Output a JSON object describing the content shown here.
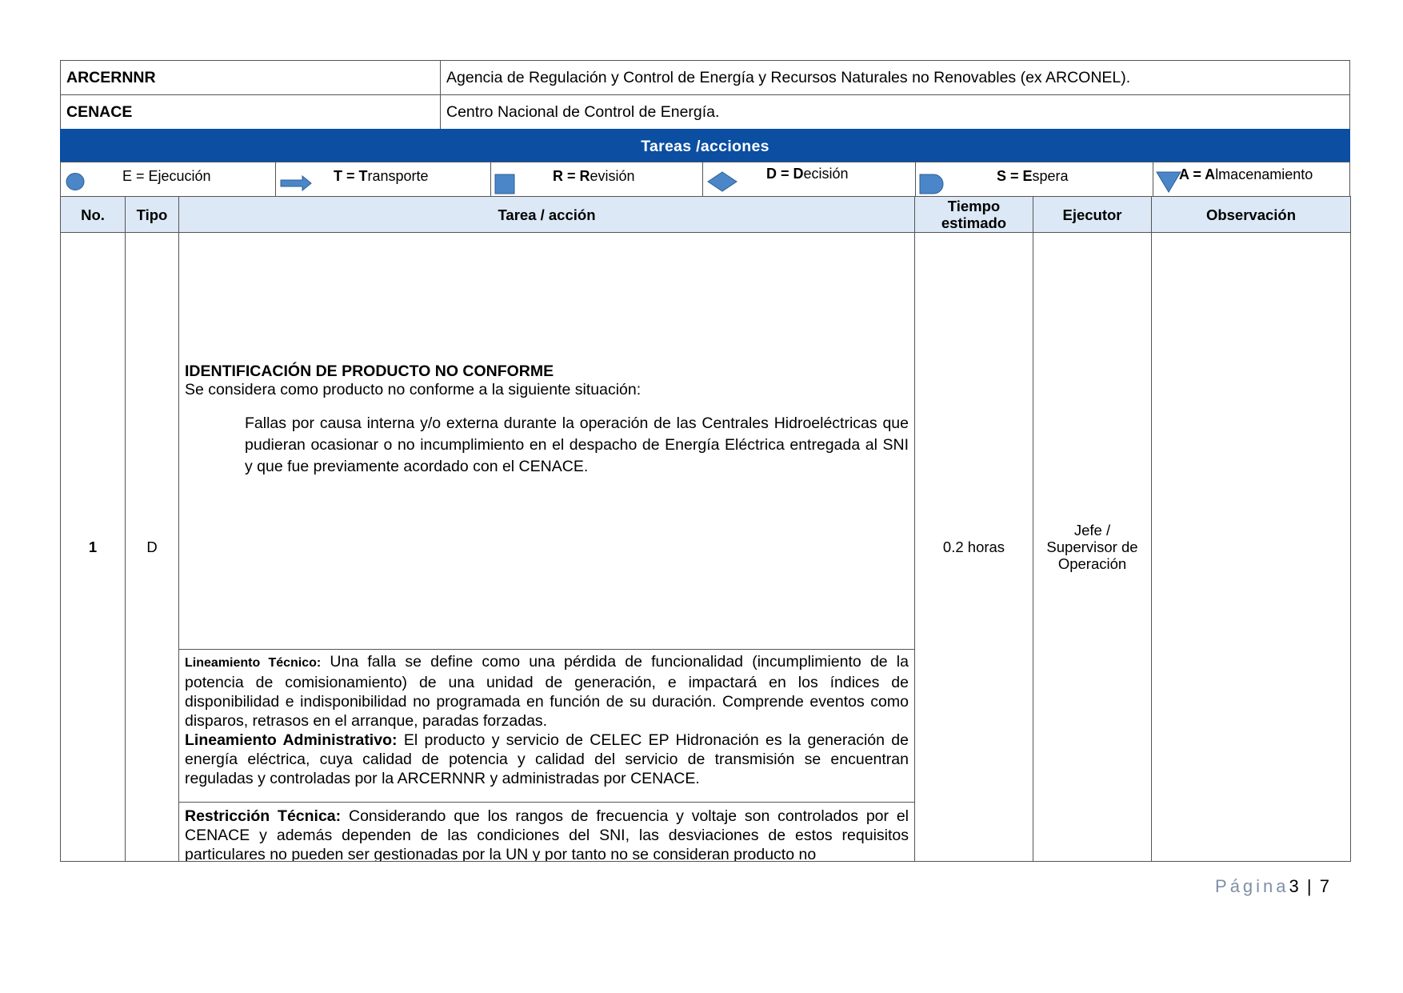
{
  "abbreviations": [
    {
      "key": "ARCERNNR",
      "value": "Agencia de Regulación y Control de Energía y Recursos Naturales no Renovables (ex ARCONEL)."
    },
    {
      "key": "CENACE",
      "value": "Centro Nacional de Control de Energía."
    }
  ],
  "legend": {
    "title": "Tareas /acciones",
    "items": [
      {
        "shape": "circle",
        "bold": "",
        "text": "E = Ejecución"
      },
      {
        "shape": "arrow",
        "bold": "T = T",
        "text": "ransporte"
      },
      {
        "shape": "square",
        "bold": "R = R",
        "text": "evisión"
      },
      {
        "shape": "diamond",
        "bold": "D = D",
        "text": "ecisión"
      },
      {
        "shape": "delay",
        "bold": "S = E",
        "text": "spera"
      },
      {
        "shape": "triangle-down",
        "bold": "A = A",
        "text": "lmacenamiento"
      }
    ],
    "shape_color": "#4a86c8"
  },
  "table": {
    "headers": {
      "no": "No.",
      "tipo": "Tipo",
      "tarea": "Tarea / acción",
      "tiempo_1": "Tiempo",
      "tiempo_2": "estimado",
      "ejecutor": "Ejecutor",
      "observacion": "Observación"
    },
    "row": {
      "no": "1",
      "tipo": "D",
      "title": "IDENTIFICACIÓN DE PRODUCTO NO CONFORME",
      "subtitle": "Se considera como producto no conforme a la siguiente situación:",
      "indent_text": "Fallas por causa interna y/o externa durante la operación de las Centrales Hidroeléctricas que pudieran ocasionar o no incumplimiento en el despacho de Energía Eléctrica entregada al SNI y que fue previamente acordado con el CENACE.",
      "lineamiento_tecnico_label": "Lineamiento Técnico:",
      "lineamiento_tecnico_text": " Una falla se define como una pérdida de funcionalidad (incumplimiento de la potencia de comisionamiento) de una unidad de generación, e impactará en los índices de disponibilidad e indisponibilidad no programada en función de su duración. Comprende eventos como disparos, retrasos en el arranque, paradas forzadas.",
      "lineamiento_admin_label": "Lineamiento Administrativo:",
      "lineamiento_admin_text": " El producto y servicio de CELEC EP Hidronación es la generación de energía eléctrica, cuya calidad de potencia y calidad del servicio de transmisión se encuentran reguladas y controladas por la ARCERNNR y administradas por CENACE.",
      "restriccion_label": "Restricción Técnica:",
      "restriccion_text": " Considerando que los rangos de frecuencia y voltaje son controlados por el CENACE y además dependen de las condiciones del SNI, las desviaciones de estos requisitos particulares no pueden ser gestionadas por la UN y por tanto no se consideran producto no",
      "tiempo": "0.2 horas",
      "ejecutor_1": "Jefe /",
      "ejecutor_2": "Supervisor de",
      "ejecutor_3": "Operación",
      "observacion": ""
    }
  },
  "footer": {
    "label": "Página",
    "page": "3",
    "separator": "|",
    "total": "7"
  }
}
